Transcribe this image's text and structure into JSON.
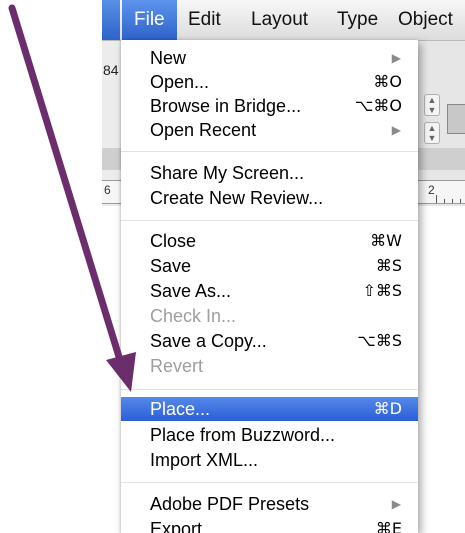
{
  "menubar": {
    "items": [
      "File",
      "Edit",
      "Layout",
      "Type",
      "Object"
    ]
  },
  "background": {
    "partial_number": "84",
    "ruler_left_label": "6",
    "ruler_right_label": "2"
  },
  "file_menu": {
    "items": [
      {
        "label": "New",
        "shortcut": "",
        "submenu": true,
        "disabled": false,
        "selected": false
      },
      {
        "label": "Open...",
        "shortcut": "⌘O",
        "submenu": false,
        "disabled": false,
        "selected": false
      },
      {
        "label": "Browse in Bridge...",
        "shortcut": "⌥⌘O",
        "submenu": false,
        "disabled": false,
        "selected": false
      },
      {
        "label": "Open Recent",
        "shortcut": "",
        "submenu": true,
        "disabled": false,
        "selected": false
      },
      {
        "label": "Share My Screen...",
        "shortcut": "",
        "submenu": false,
        "disabled": false,
        "selected": false
      },
      {
        "label": "Create New Review...",
        "shortcut": "",
        "submenu": false,
        "disabled": false,
        "selected": false
      },
      {
        "label": "Close",
        "shortcut": "⌘W",
        "submenu": false,
        "disabled": false,
        "selected": false
      },
      {
        "label": "Save",
        "shortcut": "⌘S",
        "submenu": false,
        "disabled": false,
        "selected": false
      },
      {
        "label": "Save As...",
        "shortcut": "⇧⌘S",
        "submenu": false,
        "disabled": false,
        "selected": false
      },
      {
        "label": "Check In...",
        "shortcut": "",
        "submenu": false,
        "disabled": true,
        "selected": false
      },
      {
        "label": "Save a Copy...",
        "shortcut": "⌥⌘S",
        "submenu": false,
        "disabled": false,
        "selected": false
      },
      {
        "label": "Revert",
        "shortcut": "",
        "submenu": false,
        "disabled": true,
        "selected": false
      },
      {
        "label": "Place...",
        "shortcut": "⌘D",
        "submenu": false,
        "disabled": false,
        "selected": true
      },
      {
        "label": "Place from Buzzword...",
        "shortcut": "",
        "submenu": false,
        "disabled": false,
        "selected": false
      },
      {
        "label": "Import XML...",
        "shortcut": "",
        "submenu": false,
        "disabled": false,
        "selected": false
      },
      {
        "label": "Adobe PDF Presets",
        "shortcut": "",
        "submenu": true,
        "disabled": false,
        "selected": false
      },
      {
        "label": "Export...",
        "shortcut": "⌘E",
        "submenu": false,
        "disabled": false,
        "selected": false
      }
    ],
    "submenu_arrow_icon": "triangle-right-icon"
  },
  "colors": {
    "selection": "#2a5fd8",
    "annotation_arrow": "#6b2d6b",
    "disabled_text": "#9e9e9e"
  }
}
